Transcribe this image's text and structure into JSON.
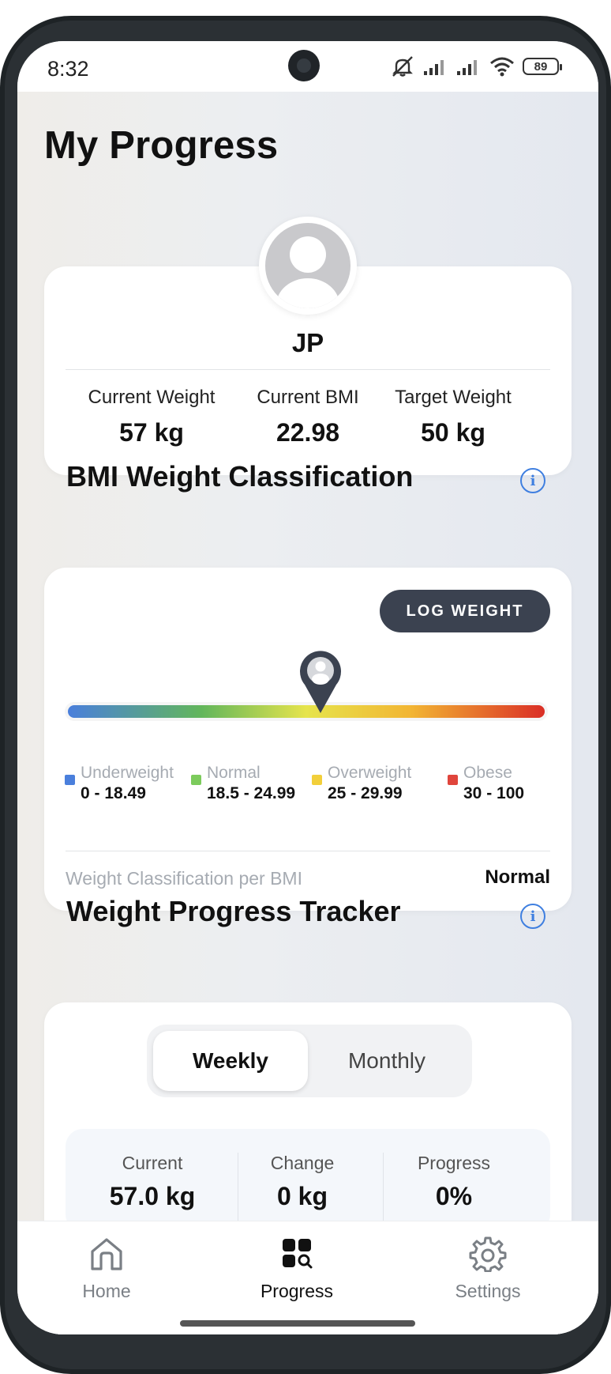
{
  "status_bar": {
    "time": "8:32",
    "battery": "89",
    "icons": [
      "mute-icon",
      "signal-icon",
      "signal-icon",
      "wifi-icon",
      "battery-icon"
    ]
  },
  "page": {
    "title": "My Progress"
  },
  "profile": {
    "initials": "JP",
    "stats": [
      {
        "label": "Current Weight",
        "value": "57 kg"
      },
      {
        "label": "Current BMI",
        "value": "22.98"
      },
      {
        "label": "Target Weight",
        "value": "50 kg"
      }
    ]
  },
  "bmi": {
    "title": "BMI Weight Classification",
    "log_button": "LOG WEIGHT",
    "pin_level": 0.53,
    "categories": [
      {
        "name": "Underweight",
        "range": "0 - 18.49",
        "color": "#4a7fdc"
      },
      {
        "name": "Normal",
        "range": "18.5 - 24.99",
        "color": "#7ccb5c"
      },
      {
        "name": "Overweight",
        "range": "25 - 29.99",
        "color": "#f2cf3a"
      },
      {
        "name": "Obese",
        "range": "30 - 100",
        "color": "#e0453c"
      }
    ],
    "classification_label": "Weight Classification per BMI",
    "classification_value": "Normal"
  },
  "tracker": {
    "title": "Weight Progress Tracker",
    "tabs": [
      "Weekly",
      "Monthly"
    ],
    "selected_tab": "Weekly",
    "summary": [
      {
        "label": "Current",
        "value": "57.0 kg"
      },
      {
        "label": "Change",
        "value": "0 kg"
      },
      {
        "label": "Progress",
        "value": "0%"
      }
    ]
  },
  "nav": {
    "items": [
      {
        "label": "Home",
        "icon": "home-icon",
        "active": false
      },
      {
        "label": "Progress",
        "icon": "grid-search-icon",
        "active": true
      },
      {
        "label": "Settings",
        "icon": "gear-icon",
        "active": false
      }
    ]
  },
  "colors": {
    "accent": "#3b4250",
    "info": "#3f7fe0",
    "inactive": "#7a7f85"
  }
}
